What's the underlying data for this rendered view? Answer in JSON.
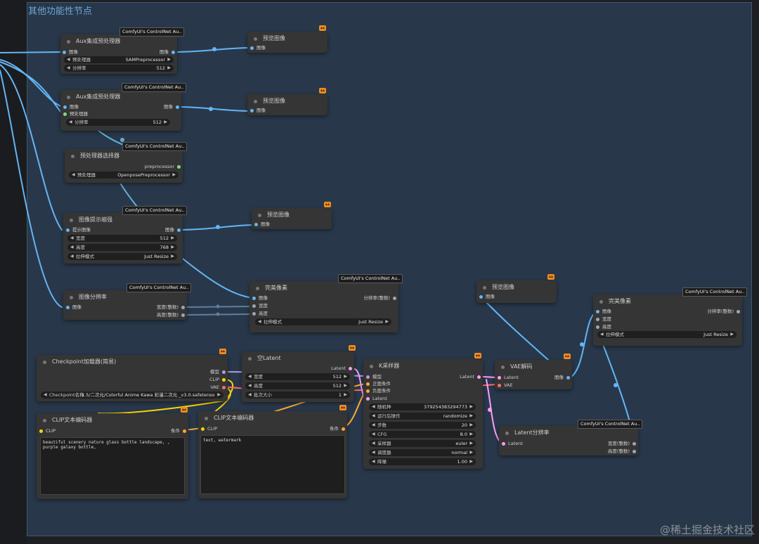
{
  "group": {
    "title": "其他功能性节点"
  },
  "badge_text": "ComfyUI's ControlNet Au..",
  "nodes": {
    "aux1": {
      "title": "Aux集成预处理器",
      "in_image": "图像",
      "out_image": "图像",
      "w_pre_label": "预处理器",
      "w_pre_value": "SAMPreprocessor",
      "w_res_label": "分辨率",
      "w_res_value": "512"
    },
    "preview1": {
      "title": "预览图像",
      "in_image": "图像"
    },
    "aux2": {
      "title": "Aux集成预处理器",
      "in_image": "图像",
      "in_pre": "预处理器",
      "out_image": "图像",
      "w_res_label": "分辨率",
      "w_res_value": "512"
    },
    "preview2": {
      "title": "预览图像",
      "in_image": "图像"
    },
    "selector": {
      "title": "预处理器选择器",
      "out_pre": "preprocessor",
      "w_pre_label": "预处理器",
      "w_pre_value": "OpenposePreprocessor"
    },
    "hint": {
      "title": "图像提示缩强",
      "in_image": "提示图像",
      "out_image": "图像",
      "w_w_label": "宽度",
      "w_w_value": "512",
      "w_h_label": "高度",
      "w_h_value": "768",
      "w_mode_label": "拉伸模式",
      "w_mode_value": "Just Resize"
    },
    "preview3": {
      "title": "预览图像",
      "in_image": "图像"
    },
    "imgres": {
      "title": "图像分辨率",
      "in_image": "图像",
      "out_w": "宽度(整数)",
      "out_h": "高度(整数)"
    },
    "perfect1": {
      "title": "完美像素",
      "in_image": "图像",
      "in_w": "宽度",
      "in_h": "高度",
      "out_res": "分辨率(整数)",
      "w_mode_label": "拉伸模式",
      "w_mode_value": "Just Resize"
    },
    "preview4": {
      "title": "预览图像",
      "in_image": "图像"
    },
    "perfect2": {
      "title": "完美像素",
      "in_image": "图像",
      "in_w": "宽度",
      "in_h": "高度",
      "out_res": "分辨率(整数)",
      "w_mode_label": "拉伸模式",
      "w_mode_value": "Just Resize"
    },
    "checkpoint": {
      "title": "Checkpoint加载器(简易)",
      "out_model": "模型",
      "out_clip": "CLIP",
      "out_vae": "VAE",
      "w_ckpt_label": "Checkpoint名称",
      "w_ckpt_value": "1.5/二次元/Colorful Anime Kawa 彩漫二次元 _v3.0.safetensors"
    },
    "latent": {
      "title": "空Latent",
      "out_latent": "Latent",
      "w_w_label": "宽度",
      "w_w_value": "512",
      "w_h_label": "高度",
      "w_h_value": "512",
      "w_b_label": "批次大小",
      "w_b_value": "1"
    },
    "ksampler": {
      "title": "K采样器",
      "in_model": "模型",
      "in_pos": "正面条件",
      "in_neg": "负面条件",
      "in_latent": "Latent",
      "out_latent": "Latent",
      "widgets": [
        {
          "label": "随机种",
          "value": "379254383294773"
        },
        {
          "label": "运行后操作",
          "value": "randomize"
        },
        {
          "label": "步数",
          "value": "20"
        },
        {
          "label": "CFG",
          "value": "8.0"
        },
        {
          "label": "采样器",
          "value": "euler"
        },
        {
          "label": "调度器",
          "value": "normal"
        },
        {
          "label": "降噪",
          "value": "1.00"
        }
      ]
    },
    "vae": {
      "title": "VAE解码",
      "in_latent": "Latent",
      "in_vae": "VAE",
      "out_image": "图像"
    },
    "latres": {
      "title": "Latent分辨率",
      "in_latent": "Latent",
      "out_w": "宽度(整数)",
      "out_h": "高度(整数)"
    },
    "clip1": {
      "title": "CLIP文本编码器",
      "in_clip": "CLIP",
      "out_cond": "条件",
      "text": "beautiful scenery nature glass bottle landscape, , purple galaxy bottle,"
    },
    "clip2": {
      "title": "CLIP文本编码器",
      "in_clip": "CLIP",
      "out_cond": "条件",
      "text": "text, watermark"
    }
  },
  "watermark": "@稀土掘金技术社区",
  "colors": {
    "image": "#64b5f6",
    "model": "#b39ddb",
    "clip": "#ffd500",
    "vae": "#ff6e6e",
    "latent": "#ff9cf9",
    "cond": "#ffa931",
    "int": "#9aa7b3",
    "pre": "#7de07d"
  }
}
